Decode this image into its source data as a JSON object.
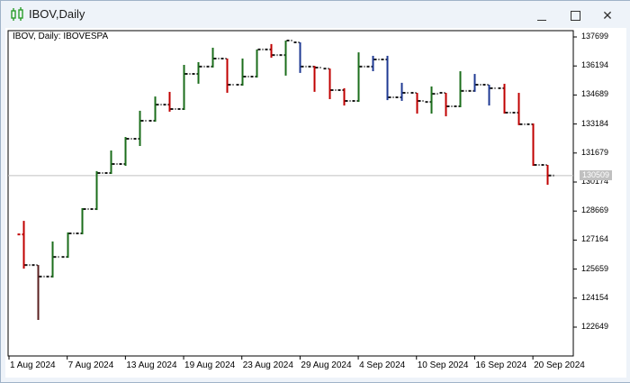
{
  "window": {
    "title": "IBOV,Daily",
    "icon": "candlestick-chart-icon",
    "buttons": {
      "minimize": "minimize-icon",
      "maximize": "maximize-icon",
      "close": "close-icon"
    }
  },
  "chart_data": {
    "type": "ohlc",
    "title": "IBOV, Daily:  IBOVESPA",
    "symbol": "IBOV",
    "timeframe": "Daily",
    "description": "IBOVESPA",
    "current_price": "130509",
    "ylim": [
      122200,
      137900
    ],
    "y_ticks": [
      "137699",
      "136194",
      "134689",
      "133184",
      "131679",
      "130174",
      "128669",
      "127164",
      "125659",
      "124154",
      "122649"
    ],
    "x_ticks": [
      {
        "label": "1 Aug 2024",
        "bar": 0
      },
      {
        "label": "7 Aug 2024",
        "bar": 4
      },
      {
        "label": "13 Aug 2024",
        "bar": 8
      },
      {
        "label": "19 Aug 2024",
        "bar": 12
      },
      {
        "label": "23 Aug 2024",
        "bar": 16
      },
      {
        "label": "29 Aug 2024",
        "bar": 20
      },
      {
        "label": "4 Sep 2024",
        "bar": 24
      },
      {
        "label": "10 Sep 2024",
        "bar": 28
      },
      {
        "label": "16 Sep 2024",
        "bar": 32
      },
      {
        "label": "20 Sep 2024",
        "bar": 36
      }
    ],
    "colors": {
      "up": "#1b6e1b",
      "down": "#c00000",
      "neutral": "#1f3a93",
      "dark": "#5a2020",
      "tick": "#1a1a1a",
      "price_line": "#c0c0c0"
    },
    "bars": [
      {
        "date": "1 Aug 2024",
        "o": 127460,
        "h": 128160,
        "l": 125730,
        "c": 125870,
        "color": "down"
      },
      {
        "date": "2 Aug 2024",
        "o": 125870,
        "h": 125870,
        "l": 123070,
        "c": 125270,
        "color": "dark"
      },
      {
        "date": "5 Aug 2024",
        "o": 125270,
        "h": 127090,
        "l": 125270,
        "c": 126290,
        "color": "up"
      },
      {
        "date": "6 Aug 2024",
        "o": 126290,
        "h": 127560,
        "l": 126290,
        "c": 127510,
        "color": "up"
      },
      {
        "date": "7 Aug 2024",
        "o": 127510,
        "h": 128820,
        "l": 127510,
        "c": 128770,
        "color": "up"
      },
      {
        "date": "8 Aug 2024",
        "o": 128770,
        "h": 130740,
        "l": 128770,
        "c": 130640,
        "color": "up"
      },
      {
        "date": "9 Aug 2024",
        "o": 130640,
        "h": 131810,
        "l": 130640,
        "c": 131110,
        "color": "up"
      },
      {
        "date": "12 Aug 2024",
        "o": 131110,
        "h": 132510,
        "l": 131060,
        "c": 132420,
        "color": "up"
      },
      {
        "date": "13 Aug 2024",
        "o": 132420,
        "h": 133870,
        "l": 132090,
        "c": 133350,
        "color": "up"
      },
      {
        "date": "14 Aug 2024",
        "o": 133350,
        "h": 134610,
        "l": 133350,
        "c": 134190,
        "color": "up"
      },
      {
        "date": "15 Aug 2024",
        "o": 134190,
        "h": 134850,
        "l": 133870,
        "c": 133960,
        "color": "down"
      },
      {
        "date": "16 Aug 2024",
        "o": 133960,
        "h": 136250,
        "l": 133960,
        "c": 135780,
        "color": "up"
      },
      {
        "date": "19 Aug 2024",
        "o": 135780,
        "h": 136390,
        "l": 135320,
        "c": 136160,
        "color": "up"
      },
      {
        "date": "20 Aug 2024",
        "o": 136160,
        "h": 137140,
        "l": 136160,
        "c": 136580,
        "color": "up"
      },
      {
        "date": "21 Aug 2024",
        "o": 136580,
        "h": 136580,
        "l": 134850,
        "c": 135220,
        "color": "down"
      },
      {
        "date": "22 Aug 2024",
        "o": 135220,
        "h": 136580,
        "l": 135220,
        "c": 135640,
        "color": "up"
      },
      {
        "date": "23 Aug 2024",
        "o": 135640,
        "h": 137050,
        "l": 135640,
        "c": 137050,
        "color": "up"
      },
      {
        "date": "26 Aug 2024",
        "o": 137050,
        "h": 137330,
        "l": 136670,
        "c": 136760,
        "color": "down"
      },
      {
        "date": "27 Aug 2024",
        "o": 136760,
        "h": 137510,
        "l": 135740,
        "c": 137510,
        "color": "up"
      },
      {
        "date": "28 Aug 2024",
        "o": 137420,
        "h": 137420,
        "l": 135880,
        "c": 136160,
        "color": "neutral"
      },
      {
        "date": "29 Aug 2024",
        "o": 136160,
        "h": 136200,
        "l": 134900,
        "c": 136110,
        "color": "down"
      },
      {
        "date": "30 Aug 2024",
        "o": 136060,
        "h": 136060,
        "l": 134520,
        "c": 134940,
        "color": "down"
      },
      {
        "date": "2 Sep 2024",
        "o": 134940,
        "h": 135040,
        "l": 134190,
        "c": 134380,
        "color": "down"
      },
      {
        "date": "3 Sep 2024",
        "o": 134380,
        "h": 136900,
        "l": 134380,
        "c": 136160,
        "color": "up"
      },
      {
        "date": "4 Sep 2024",
        "o": 136160,
        "h": 136720,
        "l": 135970,
        "c": 136530,
        "color": "neutral"
      },
      {
        "date": "5 Sep 2024",
        "o": 136530,
        "h": 136720,
        "l": 134470,
        "c": 134570,
        "color": "neutral"
      },
      {
        "date": "6 Sep 2024",
        "o": 134570,
        "h": 135320,
        "l": 134430,
        "c": 134800,
        "color": "neutral"
      },
      {
        "date": "9 Sep 2024",
        "o": 134800,
        "h": 134800,
        "l": 133770,
        "c": 134380,
        "color": "down"
      },
      {
        "date": "10 Sep 2024",
        "o": 134330,
        "h": 135130,
        "l": 133770,
        "c": 134750,
        "color": "up"
      },
      {
        "date": "11 Sep 2024",
        "o": 134800,
        "h": 134800,
        "l": 133630,
        "c": 134100,
        "color": "down"
      },
      {
        "date": "12 Sep 2024",
        "o": 134100,
        "h": 135920,
        "l": 134100,
        "c": 134900,
        "color": "up"
      },
      {
        "date": "13 Sep 2024",
        "o": 134900,
        "h": 135780,
        "l": 134900,
        "c": 135220,
        "color": "neutral"
      },
      {
        "date": "16 Sep 2024",
        "o": 135220,
        "h": 135220,
        "l": 134190,
        "c": 135040,
        "color": "neutral"
      },
      {
        "date": "17 Sep 2024",
        "o": 135040,
        "h": 135270,
        "l": 133770,
        "c": 133770,
        "color": "down"
      },
      {
        "date": "18 Sep 2024",
        "o": 133770,
        "h": 134800,
        "l": 133170,
        "c": 133170,
        "color": "down"
      },
      {
        "date": "19 Sep 2024",
        "o": 133170,
        "h": 133210,
        "l": 131060,
        "c": 131060,
        "color": "down"
      },
      {
        "date": "20 Sep 2024",
        "o": 131060,
        "h": 131060,
        "l": 130080,
        "c": 130510,
        "color": "down"
      }
    ]
  }
}
